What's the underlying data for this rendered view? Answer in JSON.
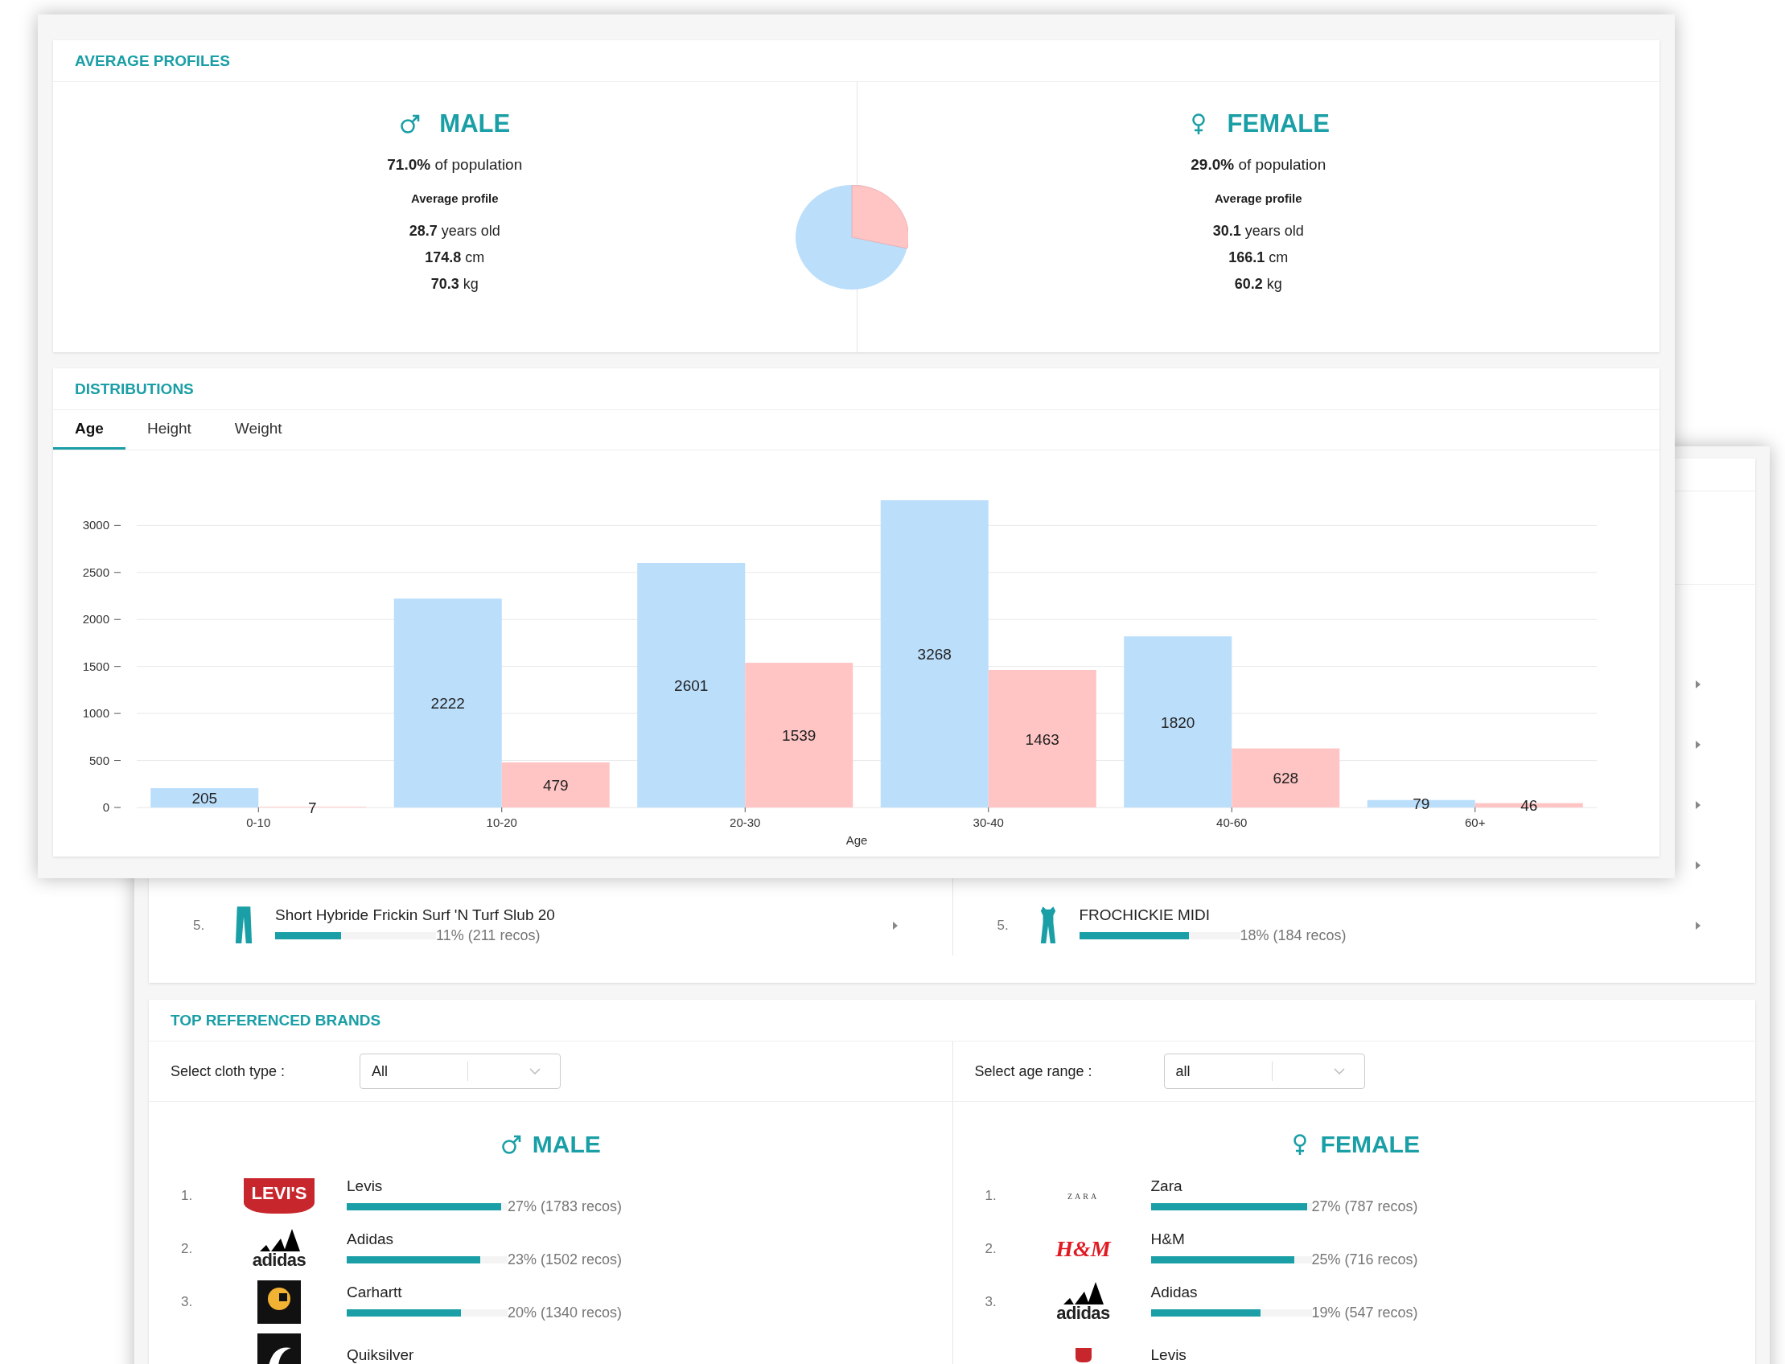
{
  "average_profiles": {
    "title": "AVERAGE PROFILES",
    "genders": [
      {
        "kind": "male",
        "heading": "MALE",
        "population": "**71.0%** of population",
        "subtitle": "Average profile",
        "stats": [
          "**28.7** years old",
          "**174.8** cm",
          "**70.3** kg"
        ]
      },
      {
        "kind": "female",
        "heading": "FEMALE",
        "population": "**29.0%** of population",
        "subtitle": "Average profile",
        "stats": [
          "**30.1** years old",
          "**166.1** cm",
          "**60.2** kg"
        ]
      }
    ]
  },
  "distributions": {
    "title": "DISTRIBUTIONS",
    "tabs": [
      {
        "label": "Age",
        "selected": true
      },
      {
        "label": "Height",
        "selected": false
      },
      {
        "label": "Weight",
        "selected": false
      }
    ],
    "chart_data": {
      "type": "bar",
      "xlabel": "Age",
      "categories": [
        "0-10",
        "10-20",
        "20-30",
        "30-40",
        "40-60",
        "60+"
      ],
      "series": [
        {
          "color": "#bbdefb",
          "values": [
            205,
            2222,
            2601,
            3268,
            1820,
            79
          ]
        },
        {
          "color": "#ffc4c4",
          "values": [
            7,
            479,
            1539,
            1463,
            628,
            46
          ]
        }
      ],
      "ylim": [
        0,
        3850
      ],
      "yticks": [
        0,
        500,
        1000,
        1500,
        2000,
        2500,
        3000
      ],
      "grid": true,
      "data_labels": true
    }
  },
  "top_products": {
    "columns": [
      {
        "kind": "male",
        "rows": [
          {
            "rank": "5.",
            "name": "Short Hybride Frickin Surf 'N Turf Slub 20",
            "level": 0.41,
            "share": "11% (211 recos)"
          }
        ]
      },
      {
        "kind": "female",
        "rows": [
          {
            "rank": "5.",
            "name": "FROCHICKIE MIDI",
            "level": 0.68,
            "share": "18% (184 recos)"
          }
        ]
      }
    ]
  },
  "top_brands": {
    "title": "TOP REFERENCED BRANDS",
    "filters": [
      {
        "label": "Select cloth type :",
        "value": "All"
      },
      {
        "label": "Select age range :",
        "value": "all"
      }
    ],
    "columns": [
      {
        "kind": "male",
        "heading": "MALE",
        "rows": [
          {
            "rank": "1.",
            "kind": "levis",
            "logo_text": "LEVI'S",
            "name": "Levis",
            "level": 0.96,
            "share": "27% (1783 recos)"
          },
          {
            "rank": "2.",
            "kind": "adidas",
            "logo_text": "adidas",
            "name": "Adidas",
            "level": 0.83,
            "share": "23% (1502 recos)"
          },
          {
            "rank": "3.",
            "kind": "carhartt",
            "name": "Carhartt",
            "level": 0.71,
            "share": "20% (1340 recos)"
          },
          {
            "kind": "quiksilver",
            "name": "Quiksilver"
          }
        ]
      },
      {
        "kind": "female",
        "heading": "FEMALE",
        "rows": [
          {
            "rank": "1.",
            "kind": "zara",
            "logo_text": "ZARA",
            "name": "Zara",
            "level": 0.97,
            "share": "27% (787 recos)"
          },
          {
            "rank": "2.",
            "kind": "hm",
            "logo_text": "H&M",
            "name": "H&M",
            "level": 0.89,
            "share": "25% (716 recos)"
          },
          {
            "rank": "3.",
            "kind": "adidas",
            "logo_text": "adidas",
            "name": "Adidas",
            "level": 0.68,
            "share": "19% (547 recos)"
          },
          {
            "kind": "levis",
            "name": "Levis"
          }
        ]
      }
    ]
  }
}
